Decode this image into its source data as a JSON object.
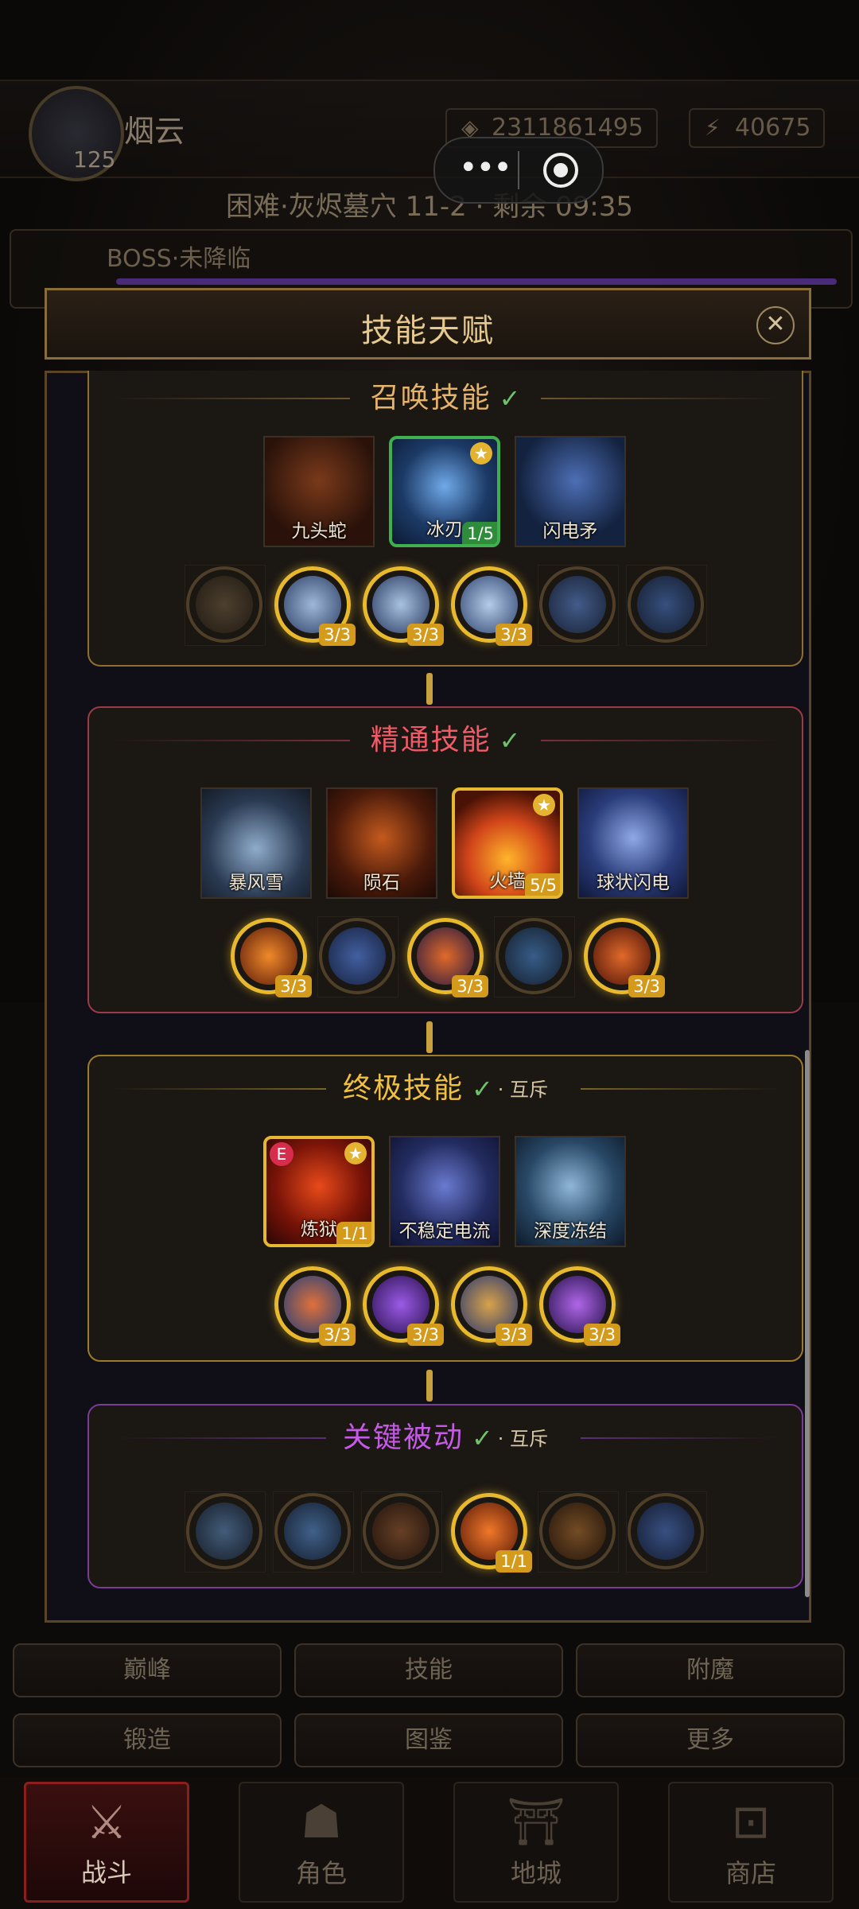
{
  "player": {
    "name": "烟云",
    "level": "125",
    "gold": "2311861495",
    "energy": "40675"
  },
  "stage": {
    "text": "困难·灰烬墓穴 11-2 · 剩余 09:35"
  },
  "boss": {
    "label": "BOSS·未降临"
  },
  "dialog": {
    "title": "技能天赋"
  },
  "sections": {
    "summon": {
      "title": "召唤技能",
      "check": "✓",
      "skills": [
        {
          "label": "九头蛇"
        },
        {
          "label": "冰刃",
          "badge": "1/5"
        },
        {
          "label": "闪电矛"
        }
      ],
      "talents": [
        "",
        "3/3",
        "3/3",
        "3/3",
        "",
        ""
      ]
    },
    "mastery": {
      "title": "精通技能",
      "check": "✓",
      "skills": [
        {
          "label": "暴风雪"
        },
        {
          "label": "陨石"
        },
        {
          "label": "火墙",
          "badge": "5/5"
        },
        {
          "label": "球状闪电"
        }
      ],
      "talents": [
        "3/3",
        "",
        "3/3",
        "",
        "3/3"
      ]
    },
    "ultimate": {
      "title": "终极技能",
      "check": "✓",
      "exclusive": "· 互斥",
      "skills": [
        {
          "label": "炼狱",
          "badge": "1/1",
          "tag": "E"
        },
        {
          "label": "不稳定电流"
        },
        {
          "label": "深度冻结"
        }
      ],
      "talents": [
        "3/3",
        "3/3",
        "3/3",
        "3/3"
      ]
    },
    "key_passive": {
      "title": "关键被动",
      "check": "✓",
      "exclusive": "· 互斥",
      "talents": [
        "",
        "",
        "",
        "1/1",
        "",
        ""
      ]
    }
  },
  "menu": {
    "row1": [
      "巅峰",
      "技能",
      "附魔"
    ],
    "row2": [
      "锻造",
      "图鉴",
      "更多"
    ]
  },
  "tabs": [
    {
      "label": "战斗",
      "icon": "crossed-swords-icon"
    },
    {
      "label": "角色",
      "icon": "helmet-icon"
    },
    {
      "label": "地城",
      "icon": "gate-icon"
    },
    {
      "label": "商店",
      "icon": "chest-icon"
    }
  ],
  "colors": {
    "summon_title": "#e6b36a",
    "mastery_title": "#ef5b68",
    "ultimate_title": "#f0c040",
    "key_title": "#c45ae6",
    "active_ring": "#e8b92c",
    "check": "#6fc26a"
  }
}
